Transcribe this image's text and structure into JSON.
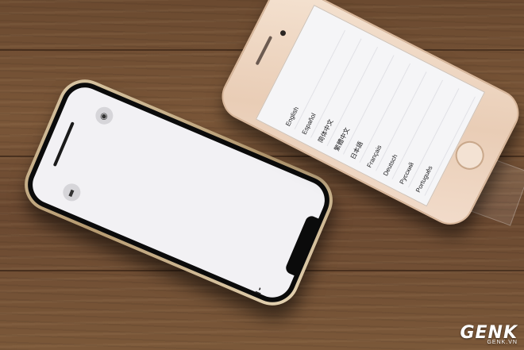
{
  "image": {
    "kind": "photo",
    "subject": "two smartphones on a wooden table"
  },
  "iphone_x": {
    "screen_color": "#f2f1f4",
    "frame_color": "#c8ac82",
    "torch_icon": "flashlight-icon",
    "camera_icon": "camera-icon"
  },
  "iphone_8": {
    "screen_color": "#f5f5f7",
    "frame_color": "#ecd3bd",
    "languages": [
      "English",
      "Español",
      "简体中文",
      "繁體中文",
      "日本語",
      "Français",
      "Deutsch",
      "Русский",
      "Português"
    ]
  },
  "watermark": {
    "logo": "GENK",
    "site": "GENK.VN",
    "color": "#ffffff"
  }
}
